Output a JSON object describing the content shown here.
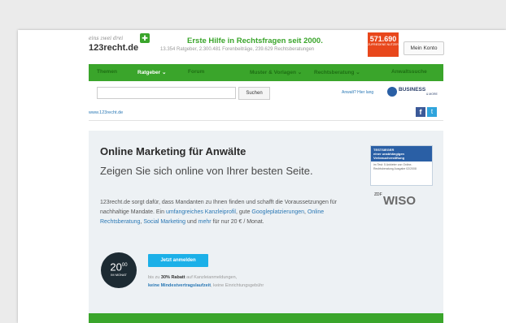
{
  "header": {
    "logo_small": "eins zwei drei",
    "logo_main": "123recht.de",
    "headline": "Erste Hilfe in Rechtsfragen seit 2000.",
    "stats": "13.354 Ratgeber, 2.300.481 Forenbeiträge, 239.629 Rechtsberatungen",
    "badge_number": "571.690",
    "badge_text": "ZUFRIEDENE NUTZER",
    "account_button": "Mein Konto"
  },
  "nav": {
    "items": [
      {
        "label": "Themen",
        "active": false
      },
      {
        "label": "Ratgeber ⌄",
        "active": true
      },
      {
        "label": "Forum",
        "active": false
      },
      {
        "label": "Muster & Vorlagen ⌄",
        "active": false
      },
      {
        "label": "Rechtsberatung ⌄",
        "active": false
      },
      {
        "label": "Anwaltssuche",
        "active": false
      }
    ]
  },
  "search": {
    "placeholder": "",
    "button": "Suchen",
    "lawyer_link": "Anwalt? Hier lang",
    "partner_name": "BUSINESS",
    "partner_sub": "& MORE"
  },
  "breadcrumb": "www.123recht.de",
  "social": {
    "facebook": "f",
    "twitter": "t"
  },
  "promo": {
    "title": "Online Marketing für Anwälte",
    "subtitle": "Zeigen Sie sich online von Ihrer besten Seite.",
    "text_1": "123recht.de sorgt dafür, dass Mandanten zu Ihnen finden und schafft die Voraussetzungen für nachhaltige Mandate. Ein",
    "link_1": "umfangreiches Kanzleiprofil",
    "text_2": ", gute",
    "link_2": "Googleplatzierungen",
    "text_3": ",",
    "link_3": "Online Rechtsberatung",
    "text_4": ",",
    "link_4": "Social Marketing",
    "text_5": "und",
    "link_5": "mehr",
    "text_6": "für nur 20 € / Monat.",
    "price": "20",
    "price_cents": "00",
    "price_period": "IM MONAT",
    "cta": "Jetzt anmelden",
    "note_1_prefix": "bis zu",
    "note_1_bold": "30% Rabatt",
    "note_1_suffix": "auf Kanzleianmeldungen,",
    "note_2_bold": "keine Mindestvertragslaufzeit",
    "note_2_suffix": ", keine Einrichtungsgebühr",
    "seal_title": "TESTSIEGER",
    "seal_line_1": "einer unabhängigen",
    "seal_line_2": "Verbraucherstiftung",
    "seal_body": "im Test: 5 Anbieter von Online-Rechtsberatung Ausgabe 02/2008",
    "tv_brand_small": "ZDF",
    "tv_brand": "WISO"
  },
  "colors": {
    "brand_green": "#3aa52b",
    "accent_blue": "#1cb0e8",
    "badge_orange": "#e8471c"
  }
}
